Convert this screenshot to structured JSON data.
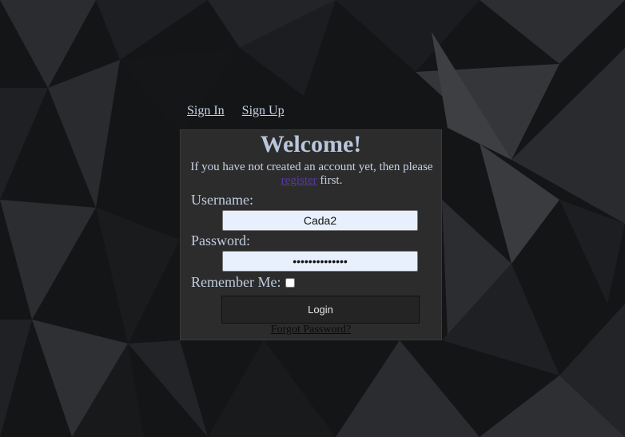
{
  "nav": {
    "sign_in": "Sign In",
    "sign_up": "Sign Up"
  },
  "card": {
    "title": "Welcome!",
    "intro_prefix": "If you have not created an account yet, then please",
    "intro_link": "register",
    "intro_suffix": "first.",
    "username_label": "Username:",
    "username_value": "Cada2",
    "password_label": "Password:",
    "password_value": "••••••••••••••",
    "remember_label": "Remember Me:",
    "remember_checked": false,
    "login_label": "Login",
    "forgot_label": "Forgot Password?"
  },
  "colors": {
    "background": "#111214",
    "card_bg": "#2c2c2c",
    "title": "#b9c7dc",
    "text": "#c0cce0",
    "link_register": "#5a3aa0",
    "input_bg": "#e8f0fe",
    "button_bg": "#242424"
  }
}
